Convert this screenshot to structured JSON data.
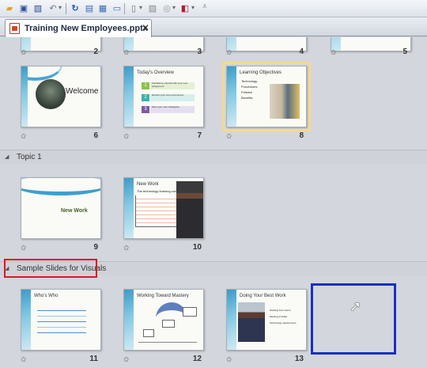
{
  "document": {
    "tab_title": "Training New Employees.pptx"
  },
  "sections": [
    {
      "name": "Topic 1"
    },
    {
      "name": "Sample Slides for Visuals"
    }
  ],
  "top_row_numbers": [
    "2",
    "3",
    "4",
    "5"
  ],
  "slides": [
    {
      "number": "6",
      "title": "Welcome"
    },
    {
      "number": "7",
      "title": "Today's Overview",
      "items": [
        "Familiarize yourself with your new assignment",
        "Review your new environment",
        "Meet your new colleagues"
      ]
    },
    {
      "number": "8",
      "title": "Learning Objectives",
      "bullets": [
        "Technology",
        "Procedures",
        "Policies",
        "Benefits"
      ]
    },
    {
      "number": "9",
      "title": "New Work"
    },
    {
      "number": "10",
      "title": "New Work",
      "subtitle": "The technology learning curve"
    },
    {
      "number": "11",
      "title": "Who's Who"
    },
    {
      "number": "12",
      "title": "Working Toward Mastery"
    },
    {
      "number": "13",
      "title": "Doing Your Best Work",
      "bullets": [
        "Working from Home",
        "Meeting of Folks",
        "Technology requirements"
      ]
    }
  ],
  "colors": {
    "accent_blue": "#3b9bc8",
    "selection": "#f6d98b",
    "section_highlight": "#d9181f",
    "drop_indicator": "#1a2fc2"
  }
}
